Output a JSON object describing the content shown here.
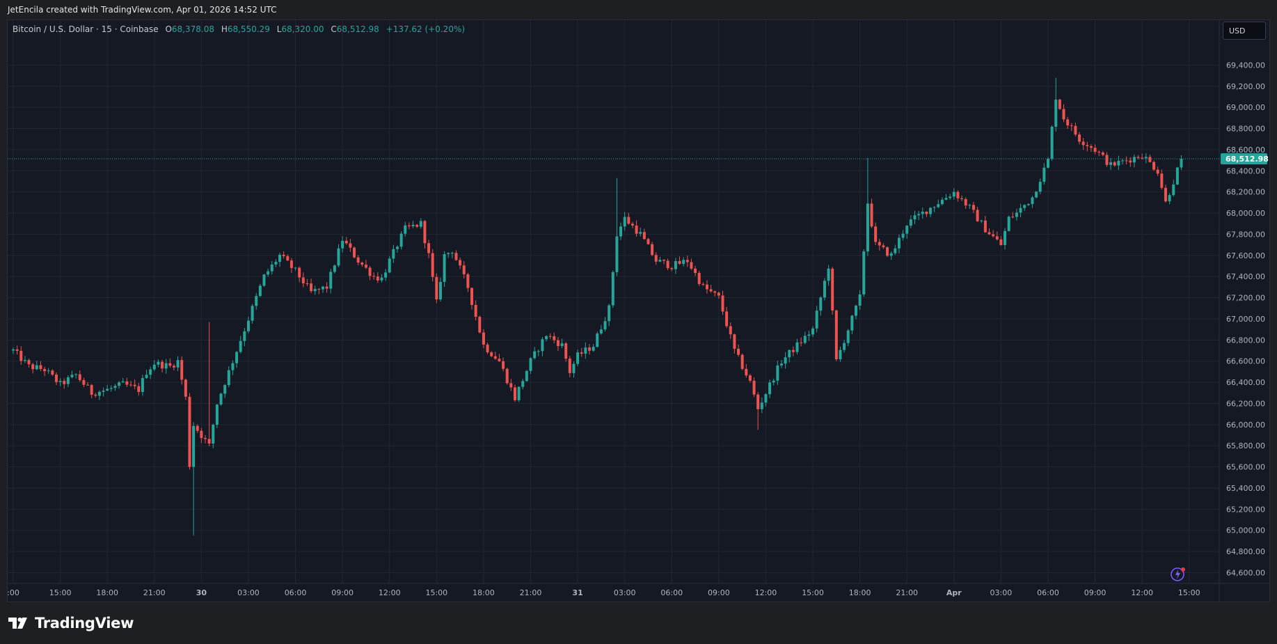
{
  "header": {
    "attribution": "JetEncila created with TradingView.com, Apr 01, 2026 14:52 UTC"
  },
  "legend": {
    "symbol": "Bitcoin / U.S. Dollar · 15 · Coinbase",
    "open_label": "O",
    "open": "68,378.08",
    "high_label": "H",
    "high": "68,550.29",
    "low_label": "L",
    "low": "68,320.00",
    "close_label": "C",
    "close": "68,512.98",
    "change": "+137.62 (+0.20%)"
  },
  "currency": "USD",
  "logo": {
    "text": "TradingView"
  },
  "colors": {
    "up": "#26a69a",
    "down": "#ef5350",
    "background": "#151924",
    "grid": "#232733",
    "axis_text": "#b2b5be",
    "price_line": "#26a69a"
  },
  "chart_data": {
    "type": "candlestick",
    "title": "",
    "xlabel": "",
    "ylabel": "",
    "ylim": [
      64500,
      69700
    ],
    "grid": true,
    "y_ticks": [
      64600,
      64800,
      65000,
      65200,
      65400,
      65600,
      65800,
      66000,
      66200,
      66400,
      66600,
      66800,
      67000,
      67200,
      67400,
      67600,
      67800,
      68000,
      68200,
      68400,
      68600,
      68800,
      69000,
      69200,
      69400
    ],
    "x_ticks": [
      {
        "label": ":00",
        "h": 12
      },
      {
        "label": "15:00",
        "h": 15
      },
      {
        "label": "18:00",
        "h": 18
      },
      {
        "label": "21:00",
        "h": 21
      },
      {
        "label": "30",
        "h": 24
      },
      {
        "label": "03:00",
        "h": 27
      },
      {
        "label": "06:00",
        "h": 30
      },
      {
        "label": "09:00",
        "h": 33
      },
      {
        "label": "12:00",
        "h": 36
      },
      {
        "label": "15:00",
        "h": 39
      },
      {
        "label": "18:00",
        "h": 42
      },
      {
        "label": "21:00",
        "h": 45
      },
      {
        "label": "31",
        "h": 48
      },
      {
        "label": "03:00",
        "h": 51
      },
      {
        "label": "06:00",
        "h": 54
      },
      {
        "label": "09:00",
        "h": 57
      },
      {
        "label": "12:00",
        "h": 60
      },
      {
        "label": "15:00",
        "h": 63
      },
      {
        "label": "18:00",
        "h": 66
      },
      {
        "label": "21:00",
        "h": 69
      },
      {
        "label": "Apr",
        "h": 72
      },
      {
        "label": "03:00",
        "h": 75
      },
      {
        "label": "06:00",
        "h": 78
      },
      {
        "label": "09:00",
        "h": 81
      },
      {
        "label": "12:00",
        "h": 84
      },
      {
        "label": "15:00",
        "h": 87
      }
    ],
    "last_price": 68512.98,
    "last_price_label": "68,512.98",
    "interval_minutes": 15,
    "anchors": [
      {
        "h": 12.0,
        "p": 66700
      },
      {
        "h": 13.0,
        "p": 66550
      },
      {
        "h": 14.0,
        "p": 66520
      },
      {
        "h": 15.0,
        "p": 66380
      },
      {
        "h": 16.0,
        "p": 66470
      },
      {
        "h": 17.0,
        "p": 66300
      },
      {
        "h": 18.0,
        "p": 66330
      },
      {
        "h": 19.0,
        "p": 66380
      },
      {
        "h": 20.0,
        "p": 66330
      },
      {
        "h": 20.5,
        "p": 66500
      },
      {
        "h": 21.0,
        "p": 66580
      },
      {
        "h": 22.0,
        "p": 66550
      },
      {
        "h": 22.5,
        "p": 66600
      },
      {
        "h": 23.0,
        "p": 66250
      },
      {
        "h": 23.25,
        "p": 65620
      },
      {
        "h": 23.5,
        "p": 66000
      },
      {
        "h": 24.0,
        "p": 65900
      },
      {
        "h": 24.5,
        "p": 65800
      },
      {
        "h": 25.0,
        "p": 66200
      },
      {
        "h": 26.0,
        "p": 66600
      },
      {
        "h": 27.0,
        "p": 67000
      },
      {
        "h": 28.0,
        "p": 67400
      },
      {
        "h": 29.0,
        "p": 67600
      },
      {
        "h": 30.0,
        "p": 67450
      },
      {
        "h": 31.0,
        "p": 67250
      },
      {
        "h": 32.0,
        "p": 67300
      },
      {
        "h": 33.0,
        "p": 67750
      },
      {
        "h": 34.0,
        "p": 67550
      },
      {
        "h": 35.0,
        "p": 67400
      },
      {
        "h": 35.5,
        "p": 67380
      },
      {
        "h": 36.0,
        "p": 67550
      },
      {
        "h": 37.0,
        "p": 67850
      },
      {
        "h": 38.0,
        "p": 67900
      },
      {
        "h": 38.5,
        "p": 67600
      },
      {
        "h": 39.0,
        "p": 67150
      },
      {
        "h": 39.5,
        "p": 67600
      },
      {
        "h": 40.0,
        "p": 67650
      },
      {
        "h": 41.0,
        "p": 67300
      },
      {
        "h": 42.0,
        "p": 66750
      },
      {
        "h": 43.0,
        "p": 66600
      },
      {
        "h": 44.0,
        "p": 66250
      },
      {
        "h": 45.0,
        "p": 66600
      },
      {
        "h": 46.0,
        "p": 66850
      },
      {
        "h": 47.0,
        "p": 66750
      },
      {
        "h": 47.5,
        "p": 66500
      },
      {
        "h": 48.0,
        "p": 66650
      },
      {
        "h": 49.0,
        "p": 66750
      },
      {
        "h": 50.0,
        "p": 67100
      },
      {
        "h": 50.5,
        "p": 67800
      },
      {
        "h": 51.0,
        "p": 67950
      },
      {
        "h": 52.0,
        "p": 67800
      },
      {
        "h": 53.0,
        "p": 67550
      },
      {
        "h": 54.0,
        "p": 67500
      },
      {
        "h": 55.0,
        "p": 67550
      },
      {
        "h": 56.0,
        "p": 67300
      },
      {
        "h": 57.0,
        "p": 67200
      },
      {
        "h": 58.0,
        "p": 66700
      },
      {
        "h": 59.0,
        "p": 66400
      },
      {
        "h": 59.5,
        "p": 66150
      },
      {
        "h": 60.0,
        "p": 66300
      },
      {
        "h": 61.0,
        "p": 66600
      },
      {
        "h": 62.0,
        "p": 66750
      },
      {
        "h": 63.0,
        "p": 66900
      },
      {
        "h": 64.0,
        "p": 67500
      },
      {
        "h": 64.5,
        "p": 66600
      },
      {
        "h": 65.0,
        "p": 66800
      },
      {
        "h": 66.0,
        "p": 67200
      },
      {
        "h": 66.5,
        "p": 68100
      },
      {
        "h": 67.0,
        "p": 67700
      },
      {
        "h": 68.0,
        "p": 67600
      },
      {
        "h": 69.0,
        "p": 67900
      },
      {
        "h": 70.0,
        "p": 68000
      },
      {
        "h": 71.0,
        "p": 68100
      },
      {
        "h": 72.0,
        "p": 68200
      },
      {
        "h": 73.0,
        "p": 68050
      },
      {
        "h": 74.0,
        "p": 67850
      },
      {
        "h": 75.0,
        "p": 67700
      },
      {
        "h": 75.5,
        "p": 67950
      },
      {
        "h": 76.0,
        "p": 68000
      },
      {
        "h": 77.0,
        "p": 68150
      },
      {
        "h": 78.0,
        "p": 68500
      },
      {
        "h": 78.5,
        "p": 69100
      },
      {
        "h": 79.0,
        "p": 68900
      },
      {
        "h": 80.0,
        "p": 68700
      },
      {
        "h": 81.0,
        "p": 68600
      },
      {
        "h": 82.0,
        "p": 68450
      },
      {
        "h": 83.0,
        "p": 68500
      },
      {
        "h": 84.0,
        "p": 68550
      },
      {
        "h": 85.0,
        "p": 68400
      },
      {
        "h": 85.5,
        "p": 68100
      },
      {
        "h": 86.0,
        "p": 68300
      },
      {
        "h": 86.5,
        "p": 68512.98
      }
    ]
  }
}
